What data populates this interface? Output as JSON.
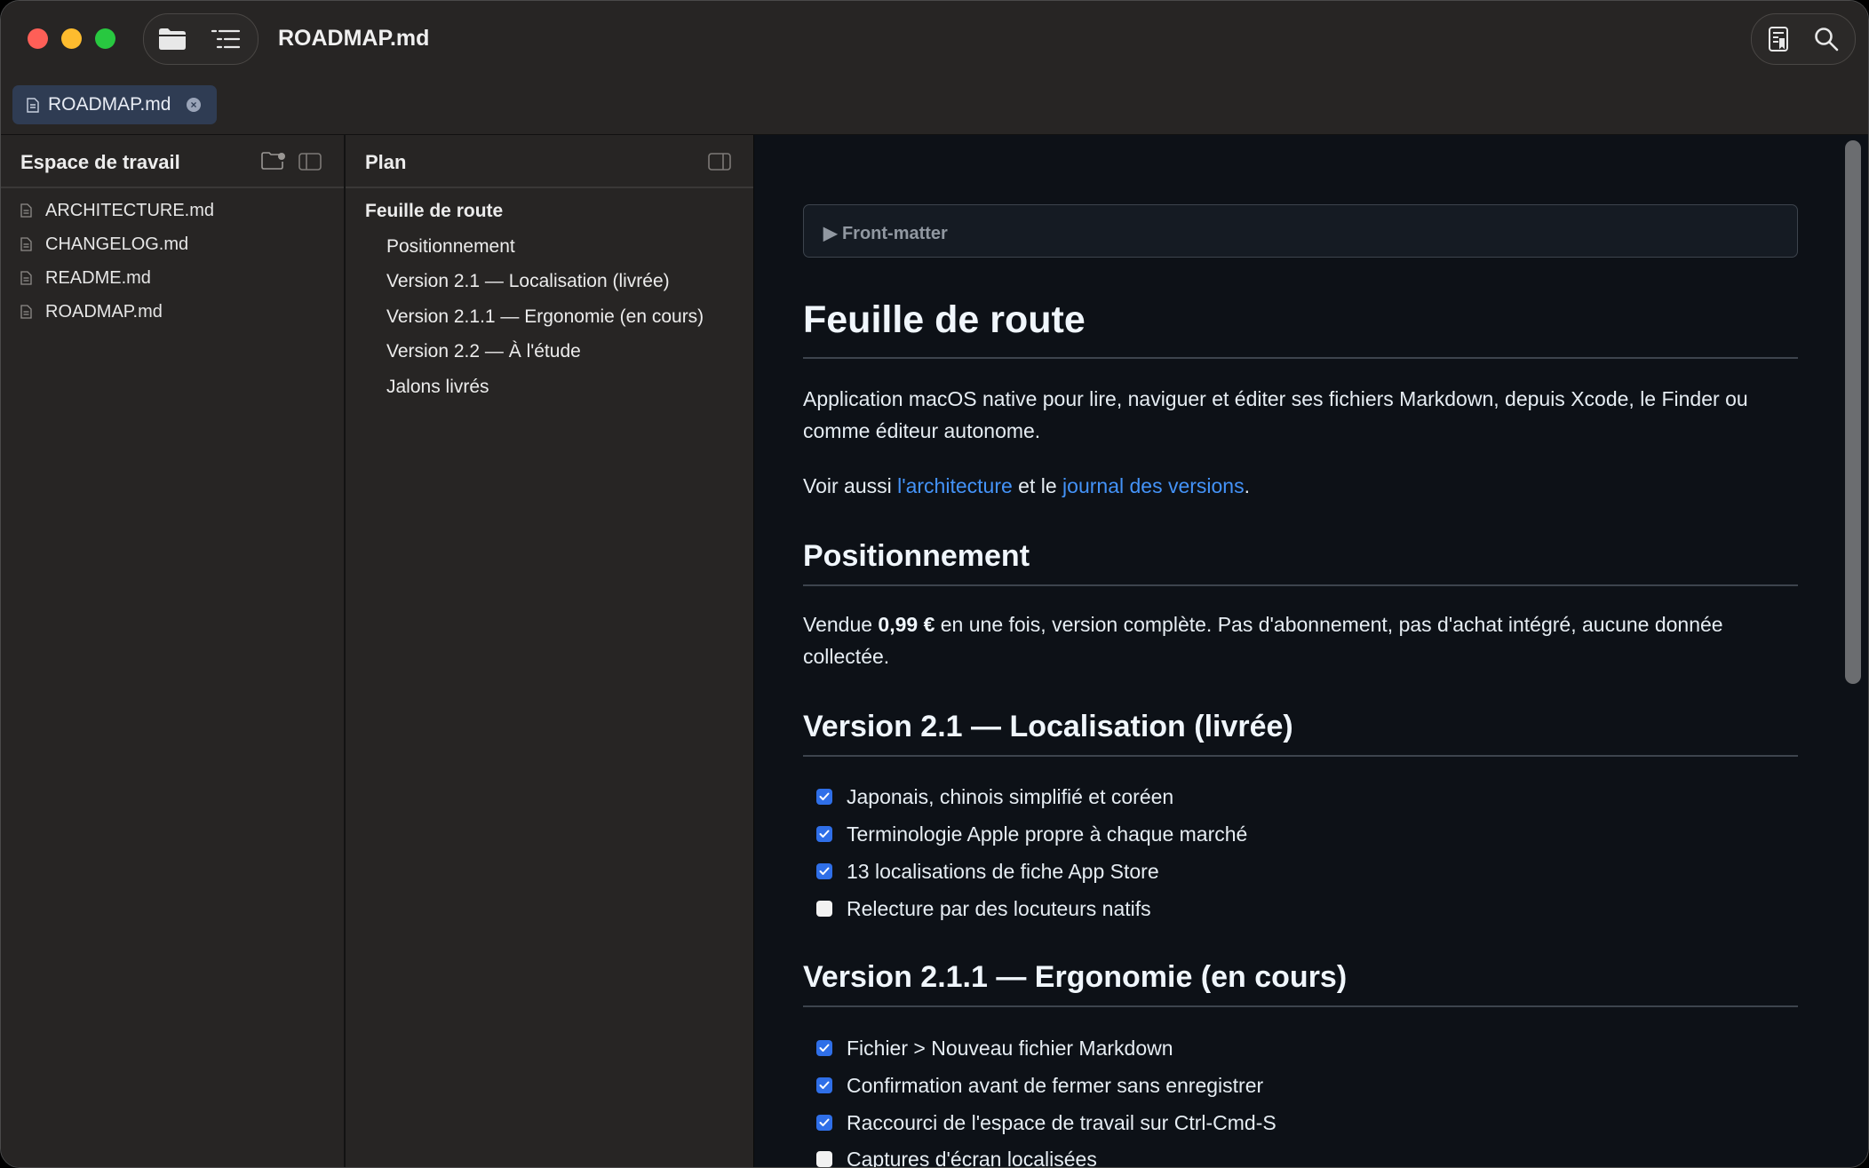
{
  "window": {
    "title": "ROADMAP.md"
  },
  "tabs": [
    {
      "label": "ROADMAP.md",
      "close_icon": "close-circle-icon"
    }
  ],
  "toolbar": {
    "left_icons": [
      "folder-icon",
      "outline-list-icon"
    ],
    "right_icons": [
      "reader-mode-icon",
      "search-icon"
    ]
  },
  "sidebar": {
    "title": "Espace de travail",
    "files": [
      "ARCHITECTURE.md",
      "CHANGELOG.md",
      "README.md",
      "ROADMAP.md"
    ]
  },
  "outline": {
    "title": "Plan",
    "items": [
      {
        "label": "Feuille de route",
        "level": 1
      },
      {
        "label": "Positionnement",
        "level": 2
      },
      {
        "label": "Version 2.1 — Localisation (livrée)",
        "level": 2
      },
      {
        "label": "Version 2.1.1 — Ergonomie (en cours)",
        "level": 2
      },
      {
        "label": "Version 2.2 — À l'étude",
        "level": 2
      },
      {
        "label": "Jalons livrés",
        "level": 2
      }
    ]
  },
  "document": {
    "front_matter": "▶ Front-matter",
    "title": "Feuille de route",
    "intro": "Application macOS native pour lire, naviguer et éditer ses fichiers Markdown, depuis Xcode, le Finder ou comme éditeur autonome.",
    "see_also": {
      "prefix": "Voir aussi ",
      "link1": "l'architecture",
      "middle": " et le ",
      "link2": "journal des versions",
      "suffix": "."
    },
    "positioning": {
      "heading": "Positionnement",
      "prefix": "Vendue ",
      "price": "0,99 €",
      "suffix": " en une fois, version complète. Pas d'abonnement, pas d'achat intégré, aucune donnée collectée."
    },
    "v21": {
      "heading": "Version 2.1 — Localisation (livrée)",
      "tasks": [
        {
          "label": "Japonais, chinois simplifié et coréen",
          "checked": true
        },
        {
          "label": "Terminologie Apple propre à chaque marché",
          "checked": true
        },
        {
          "label": "13 localisations de fiche App Store",
          "checked": true
        },
        {
          "label": "Relecture par des locuteurs natifs",
          "checked": false
        }
      ]
    },
    "v211": {
      "heading": "Version 2.1.1 — Ergonomie (en cours)",
      "tasks": [
        {
          "label": "Fichier > Nouveau fichier Markdown",
          "checked": true
        },
        {
          "label": "Confirmation avant de fermer sans enregistrer",
          "checked": true
        },
        {
          "label": "Raccourci de l'espace de travail sur Ctrl-Cmd-S",
          "checked": true
        },
        {
          "label": "Captures d'écran localisées",
          "checked": false
        }
      ]
    }
  },
  "colors": {
    "accent": "#2f6fe8",
    "link": "#4493f8",
    "tab_active": "#2f3c53"
  }
}
